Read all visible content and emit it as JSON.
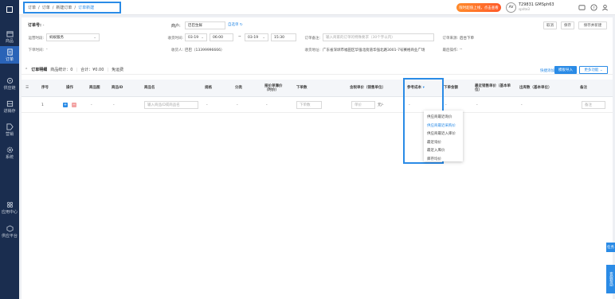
{
  "breadcrumb": [
    "订单",
    "订单",
    "新建订单",
    "订单新建"
  ],
  "topbar": {
    "cta": "限时超值上线，点击查看",
    "avatar": "AV",
    "account_id": "T29831 GMSph63",
    "account_sub": "sprite3"
  },
  "sidebar": [
    {
      "label": "商品",
      "icon": "box-icon"
    },
    {
      "label": "订单",
      "icon": "order-icon",
      "active": true
    },
    {
      "label": "供应链",
      "icon": "supply-chain-icon"
    },
    {
      "label": "进销存",
      "icon": "inventory-icon"
    },
    {
      "label": "营销",
      "icon": "tag-icon"
    },
    {
      "label": "系统",
      "icon": "gear-icon"
    },
    {
      "label": "应用中心",
      "icon": "apps-icon"
    },
    {
      "label": "供应平台",
      "icon": "platform-icon"
    }
  ],
  "header": {
    "order_no_label": "订单号:",
    "order_no_value": "-",
    "merchant_label": "商户:",
    "merchant_value": "巴巴生鲜",
    "merchant_link": "自选单",
    "btn_cancel": "取消",
    "btn_save": "保存",
    "btn_save_new": "保存并新建"
  },
  "form": {
    "warehouse_label": "运营时段:",
    "warehouse_value": "蚂蚁服务",
    "order_time_label": "收货时间:",
    "date1": "03-19",
    "time1": "06:00",
    "sep": "~",
    "date2": "03-19",
    "time2": "15:30",
    "remark_label": "订单备注:",
    "remark_placeholder": "输入商家的订单的特殊要求（30个字以内）",
    "source_label": "订单来源:",
    "source_value": "后台下单",
    "order_time2_label": "下单时间:",
    "order_time2_value": "-",
    "receiver_label": "收货人:",
    "receiver_value": "巴巴（13399996666）",
    "address_label": "收货地址:",
    "address_value": "广东省深圳市福田区华强北街道华强北路3001-7号赛格商业广场",
    "operator_label": "最后操作:",
    "operator_value": "--"
  },
  "section": {
    "title": "订单明细",
    "stat1": "商品统计：0",
    "stat2": "合计：¥0.00",
    "stat3": "免运费",
    "link_batch": "快捷添加",
    "btn_import": "模板导入",
    "btn_more": "更多功能"
  },
  "table": {
    "headers": [
      "序号",
      "操作",
      "商品图",
      "商品ID",
      "商品名",
      "规格",
      "分类",
      "报价单簿价（时价）",
      "下单数",
      "含税单价（销售单位）",
      "参考成本",
      "下单金额",
      "最近销售单价（基本单位）",
      "出库数（基本单位）",
      "备注"
    ],
    "row": {
      "index": "1",
      "img": "-",
      "id": "-",
      "name_placeholder": "输入商品ID或商品名",
      "spec": "-",
      "category": "-",
      "quote": "-",
      "qty_placeholder": "下单数",
      "price_placeholder": "单价",
      "price_unit": "元/-",
      "cost": "-",
      "amount": "-",
      "recent_price": "-",
      "out_qty": "-",
      "remark_placeholder": "备注"
    }
  },
  "cost_dropdown": {
    "items": [
      "供应商最近询价",
      "供应商最近采购价",
      "供应商最近入库价",
      "最近询价",
      "最近入库价",
      "库存均价"
    ],
    "selected_index": 1
  },
  "side_tabs": [
    "任务",
    "客服帮助"
  ]
}
